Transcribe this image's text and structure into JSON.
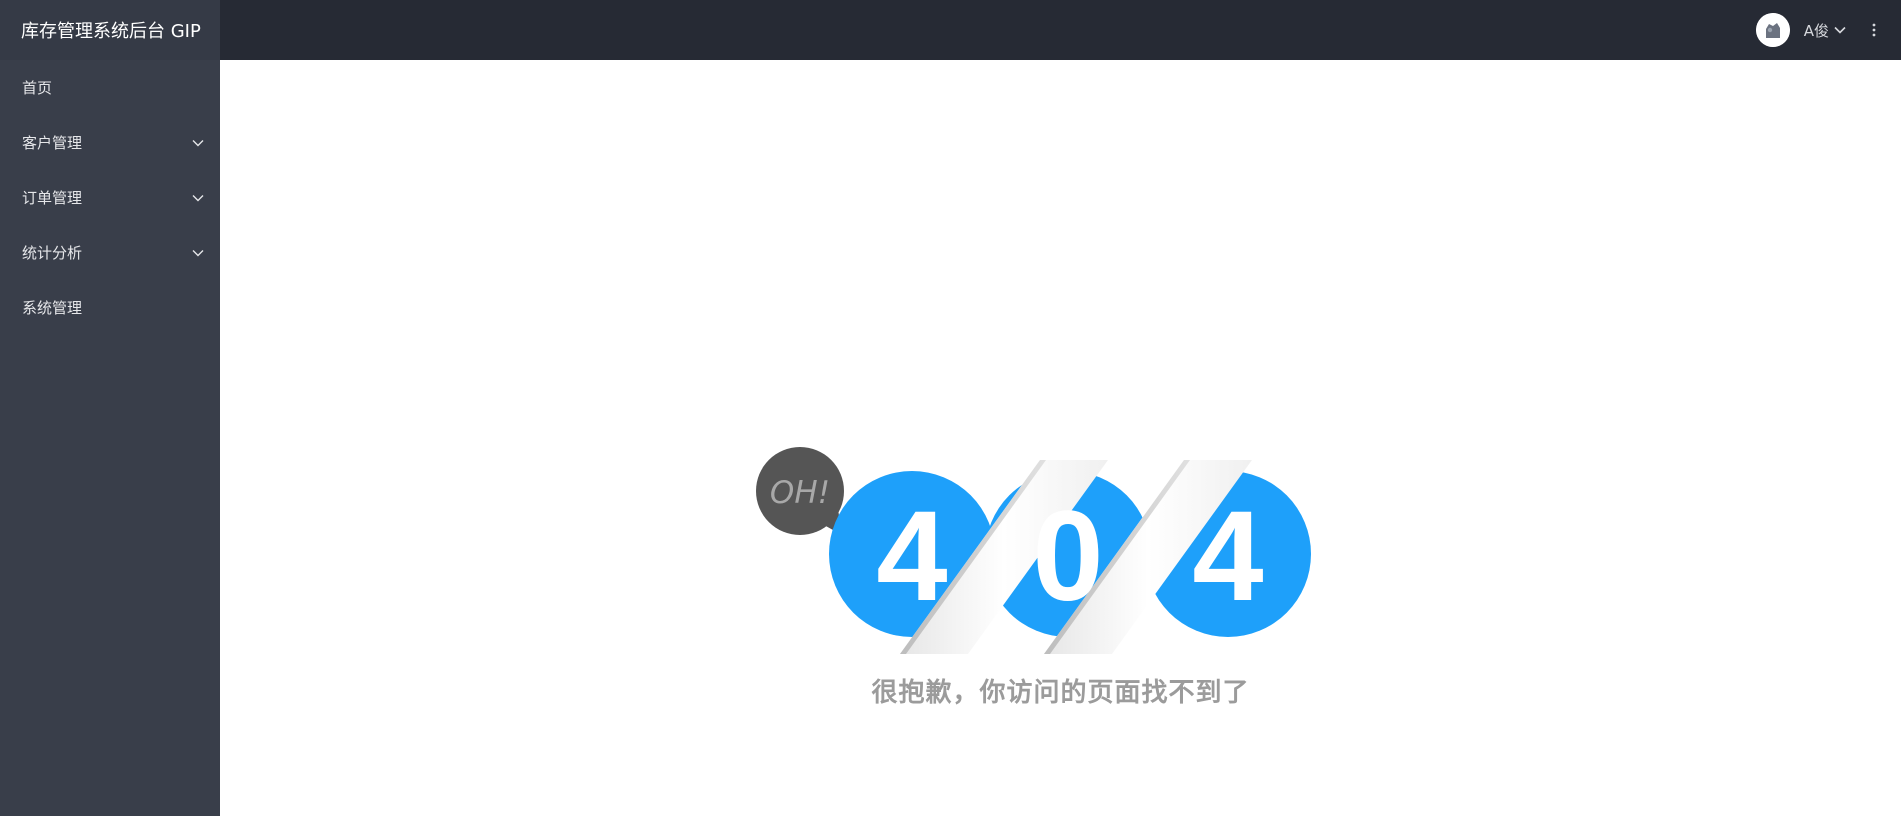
{
  "header": {
    "brand_title": "库存管理系统后台 GIP",
    "user_name": "A俊"
  },
  "sidebar": {
    "items": [
      {
        "label": "首页",
        "has_submenu": false
      },
      {
        "label": "客户管理",
        "has_submenu": true
      },
      {
        "label": "订单管理",
        "has_submenu": true
      },
      {
        "label": "统计分析",
        "has_submenu": true
      },
      {
        "label": "系统管理",
        "has_submenu": false
      }
    ]
  },
  "error_page": {
    "bubble_text": "OH!",
    "code_digits": [
      "4",
      "0",
      "4"
    ],
    "message": "很抱歉，你访问的页面找不到了"
  },
  "colors": {
    "topbar": "#262a34",
    "brand_bg": "#353a46",
    "sidebar": "#393e4a",
    "accent_blue": "#1ea0fa",
    "bubble": "#555555",
    "message_text": "#9b9b9b"
  },
  "icons": {
    "avatar": "avatar-image",
    "user_menu": "chevron-down-icon",
    "more": "more-vertical-icon",
    "submenu": "chevron-down-icon"
  }
}
